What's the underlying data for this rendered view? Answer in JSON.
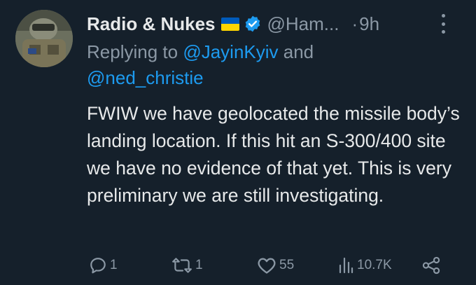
{
  "tweet": {
    "display_name": "Radio & Nukes",
    "handle": "@Ham...",
    "time_sep": "·",
    "time": "9h",
    "reply_prefix": "Replying to",
    "reply_user1": "@JayinKyiv",
    "reply_and": "and",
    "reply_user2": "@ned_christie",
    "text": "FWIW we have geolocated the missile body’s landing location. If this hit an S-300/400 site we have no evidence of that yet. This is very preliminary we are still investigating."
  },
  "actions": {
    "reply_count": "1",
    "retweet_count": "1",
    "like_count": "55",
    "views_count": "10.7K"
  },
  "icons": [
    "ukraine-flag-icon",
    "verified-badge-icon",
    "more-icon",
    "reply-icon",
    "retweet-icon",
    "like-icon",
    "views-icon",
    "share-icon"
  ],
  "colors": {
    "background": "#15202b",
    "text": "#e7e9ea",
    "secondary": "#8b98a5",
    "accent": "#1d9bf0",
    "flag_blue": "#005bbb",
    "flag_yellow": "#ffd500"
  }
}
